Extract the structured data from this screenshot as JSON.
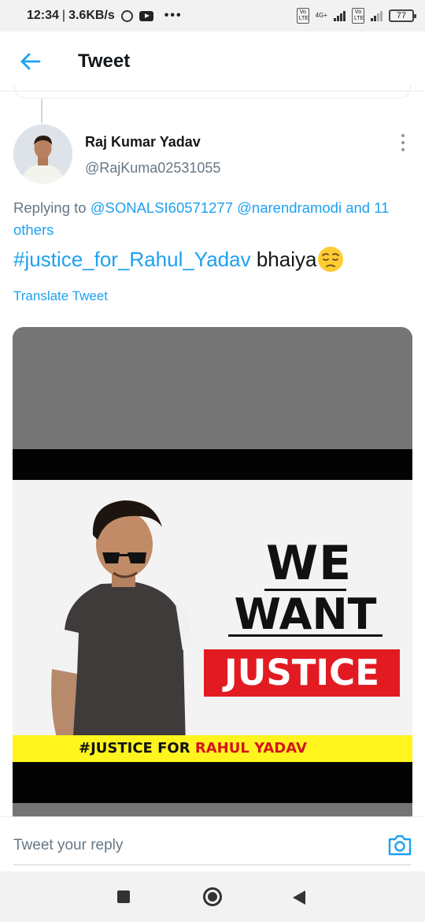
{
  "status_bar": {
    "time": "12:34",
    "separator": "|",
    "speed": "3.6KB/s",
    "more": "•••",
    "sim1_label": "Vo LTE",
    "sim1_network": "4G+",
    "sim2_label": "Vo LTE",
    "battery": "77"
  },
  "header": {
    "title": "Tweet"
  },
  "tweet": {
    "author_name": "Raj Kumar Yadav",
    "author_handle": "@RajKuma02531055",
    "replying_prefix": "Replying to",
    "mention_1": "@SONALSI60571277",
    "mention_2": "@narendramodi",
    "conjunction": "and",
    "others": "11 others",
    "hashtag": "#justice_for_Rahul_Yadav",
    "text_after": "bhaiya",
    "translate": "Translate Tweet",
    "media": {
      "poster_line_1": "WE",
      "poster_line_2": "WANT",
      "poster_line_3": "JUSTICE",
      "banner_prefix": "#JUSTICE FOR",
      "banner_name": "RAHUL YADAV"
    }
  },
  "reply": {
    "placeholder": "Tweet your reply"
  },
  "colors": {
    "accent": "#1da1f2",
    "muted": "#657786",
    "justice_red": "#e21b23",
    "banner_yellow": "#fff41e"
  },
  "icons": [
    "back-arrow-icon",
    "more-vertical-icon",
    "pensive-face-emoji",
    "camera-icon",
    "nav-recents-icon",
    "nav-home-icon",
    "nav-back-icon"
  ]
}
